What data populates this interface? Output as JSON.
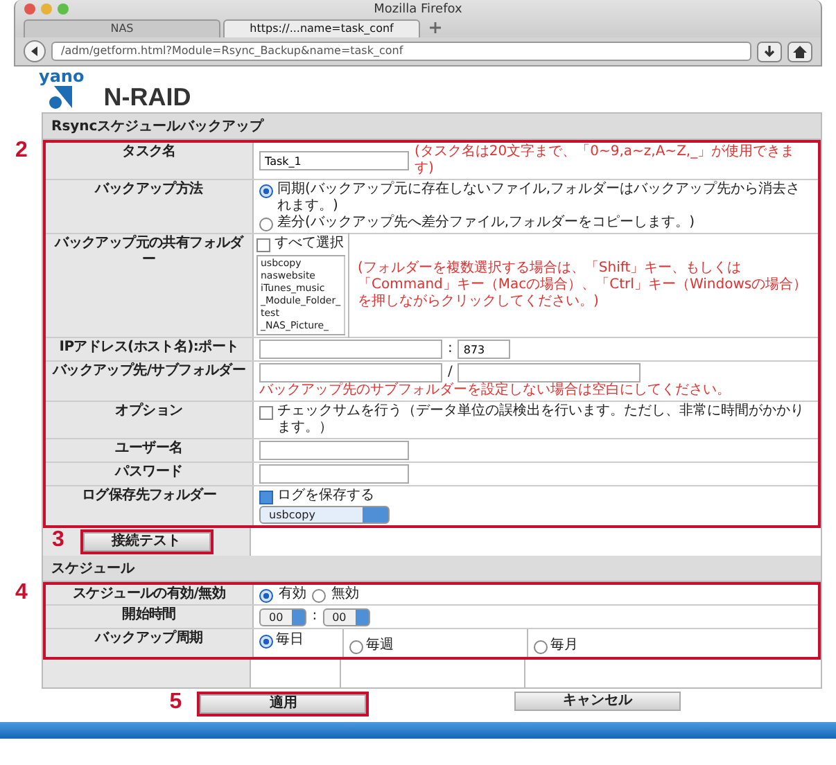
{
  "browser": {
    "window_title": "Mozilla Firefox",
    "tabs": [
      {
        "label": "NAS",
        "selected": false
      },
      {
        "label": "https://...name=task_conf",
        "selected": true
      }
    ],
    "url": "/adm/getform.html?Module=Rsync_Backup&name=task_conf"
  },
  "logo": {
    "brand": "yano",
    "product": "N-RAID"
  },
  "sections": [
    {
      "title": "Rsyncスケジュールバックアップ",
      "groups": [
        {
          "callout": "2",
          "rows": [
            {
              "kind": "text",
              "label": "タスク名",
              "value": "Task_1",
              "note": "(タスク名は20文字まで、「0~9,a~z,A~Z,_」が使用できます)"
            },
            {
              "kind": "radio",
              "label": "バックアップ方法",
              "options": [
                {
                  "label": "同期(バックアップ元に存在しないファイル,フォルダーはバックアップ先から消去されます。)",
                  "selected": true
                },
                {
                  "label": "差分(バックアップ先へ差分ファイル,フォルダーをコピーします。)",
                  "selected": false
                }
              ]
            },
            {
              "kind": "folders",
              "label": "バックアップ元の共有フォルダー",
              "select_all": {
                "label": "すべて選択",
                "checked": false
              },
              "items": [
                "usbcopy",
                "naswebsite",
                "iTunes_music",
                "_Module_Folder_",
                "test",
                "_NAS_Picture_"
              ],
              "note": "(フォルダーを複数選択する場合は、「Shift」キー、もしくは「Command」キー（Macの場合）、「Ctrl」キー（Windowsの場合）を押しながらクリックしてください。)"
            },
            {
              "kind": "pair",
              "label": "IPアドレス(ホスト名):ポート",
              "separator": ":",
              "second": "873"
            },
            {
              "kind": "pair",
              "label": "バックアップ先/サブフォルダー",
              "separator": "/",
              "note": "バックアップ先のサブフォルダーを設定しない場合は空白にしてください。"
            },
            {
              "kind": "check",
              "label": "オプション",
              "option": {
                "label": "チェックサムを行う（データ単位の誤検出を行います。ただし、非常に時間がかかります。）",
                "checked": false
              }
            },
            {
              "kind": "text",
              "label": "ユーザー名"
            },
            {
              "kind": "text",
              "label": "パスワード"
            },
            {
              "kind": "log",
              "label": "ログ保存先フォルダー",
              "option": {
                "label": "ログを保存する",
                "checked": true
              },
              "folder": "usbcopy"
            }
          ]
        },
        {
          "rows": [
            {
              "kind": "button",
              "label": "接続テスト",
              "callout": "3"
            }
          ]
        }
      ]
    },
    {
      "title": "スケジュール",
      "groups": [
        {
          "callout": "4",
          "rows": [
            {
              "kind": "radio-inline",
              "label": "スケジュールの有効/無効",
              "options": [
                {
                  "label": "有効",
                  "selected": true
                },
                {
                  "label": "無効",
                  "selected": false
                }
              ]
            },
            {
              "kind": "time",
              "label": "開始時間",
              "hour": "00",
              "separator": ":",
              "minute": "00"
            },
            {
              "kind": "cycle",
              "label": "バックアップ周期",
              "options": [
                {
                  "label": "毎日",
                  "selected": true
                },
                {
                  "label": "毎週",
                  "selected": false
                },
                {
                  "label": "毎月",
                  "selected": false
                }
              ]
            }
          ]
        },
        {
          "rows": [
            {
              "kind": "empty"
            }
          ]
        }
      ]
    }
  ],
  "actions": [
    {
      "label": "適用",
      "callout": "5"
    },
    {
      "label": "キャンセル"
    }
  ]
}
